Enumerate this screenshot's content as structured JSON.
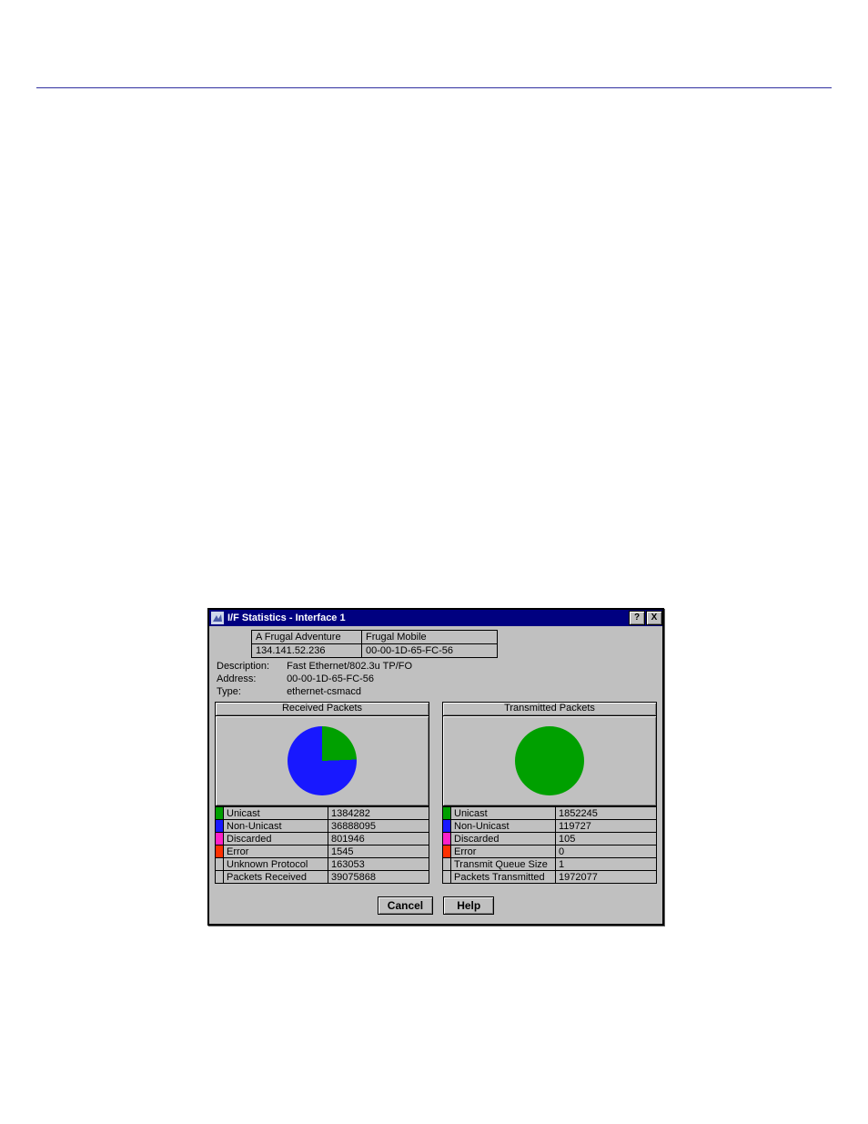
{
  "dialog": {
    "title": "I/F Statistics - Interface 1",
    "help_btn": "?",
    "close_btn": "X"
  },
  "info_table": [
    [
      "A Frugal Adventure",
      "Frugal Mobile"
    ],
    [
      "134.141.52.236",
      "00-00-1D-65-FC-56"
    ]
  ],
  "meta": {
    "description_label": "Description:",
    "description_value": "Fast Ethernet/802.3u TP/FO",
    "address_label": "Address:",
    "address_value": "00-00-1D-65-FC-56",
    "type_label": "Type:",
    "type_value": "ethernet-csmacd"
  },
  "colors": {
    "unicast": "#00A000",
    "nonunicast": "#1818FF",
    "discarded": "#FF20C8",
    "error": "#FF3000"
  },
  "panels": {
    "received": {
      "title": "Received Packets",
      "rows": [
        {
          "swatch": "unicast",
          "label": "Unicast",
          "value": "1384282"
        },
        {
          "swatch": "nonunicast",
          "label": "Non-Unicast",
          "value": "36888095"
        },
        {
          "swatch": "discarded",
          "label": "Discarded",
          "value": "801946"
        },
        {
          "swatch": "error",
          "label": "Error",
          "value": "1545"
        },
        {
          "swatch": "",
          "label": "Unknown Protocol",
          "value": "163053"
        },
        {
          "swatch": "",
          "label": "Packets Received",
          "value": "39075868"
        }
      ]
    },
    "transmitted": {
      "title": "Transmitted Packets",
      "rows": [
        {
          "swatch": "unicast",
          "label": "Unicast",
          "value": "1852245"
        },
        {
          "swatch": "nonunicast",
          "label": "Non-Unicast",
          "value": "119727"
        },
        {
          "swatch": "discarded",
          "label": "Discarded",
          "value": "105"
        },
        {
          "swatch": "error",
          "label": "Error",
          "value": "0"
        },
        {
          "swatch": "",
          "label": "Transmit Queue Size",
          "value": "1"
        },
        {
          "swatch": "",
          "label": "Packets Transmitted",
          "value": "1972077"
        }
      ]
    }
  },
  "buttons": {
    "cancel": "Cancel",
    "help": "Help"
  },
  "chart_data": [
    {
      "type": "pie",
      "title": "Received Packets",
      "series": [
        {
          "name": "Unicast",
          "value": 1384282,
          "color": "#00A000"
        },
        {
          "name": "Non-Unicast",
          "value": 36888095,
          "color": "#1818FF"
        },
        {
          "name": "Discarded",
          "value": 801946,
          "color": "#FF20C8"
        },
        {
          "name": "Error",
          "value": 1545,
          "color": "#FF3000"
        }
      ]
    },
    {
      "type": "pie",
      "title": "Transmitted Packets",
      "series": [
        {
          "name": "Unicast",
          "value": 1852245,
          "color": "#00A000"
        },
        {
          "name": "Non-Unicast",
          "value": 119727,
          "color": "#1818FF"
        },
        {
          "name": "Discarded",
          "value": 105,
          "color": "#FF20C8"
        },
        {
          "name": "Error",
          "value": 0,
          "color": "#FF3000"
        }
      ]
    }
  ]
}
